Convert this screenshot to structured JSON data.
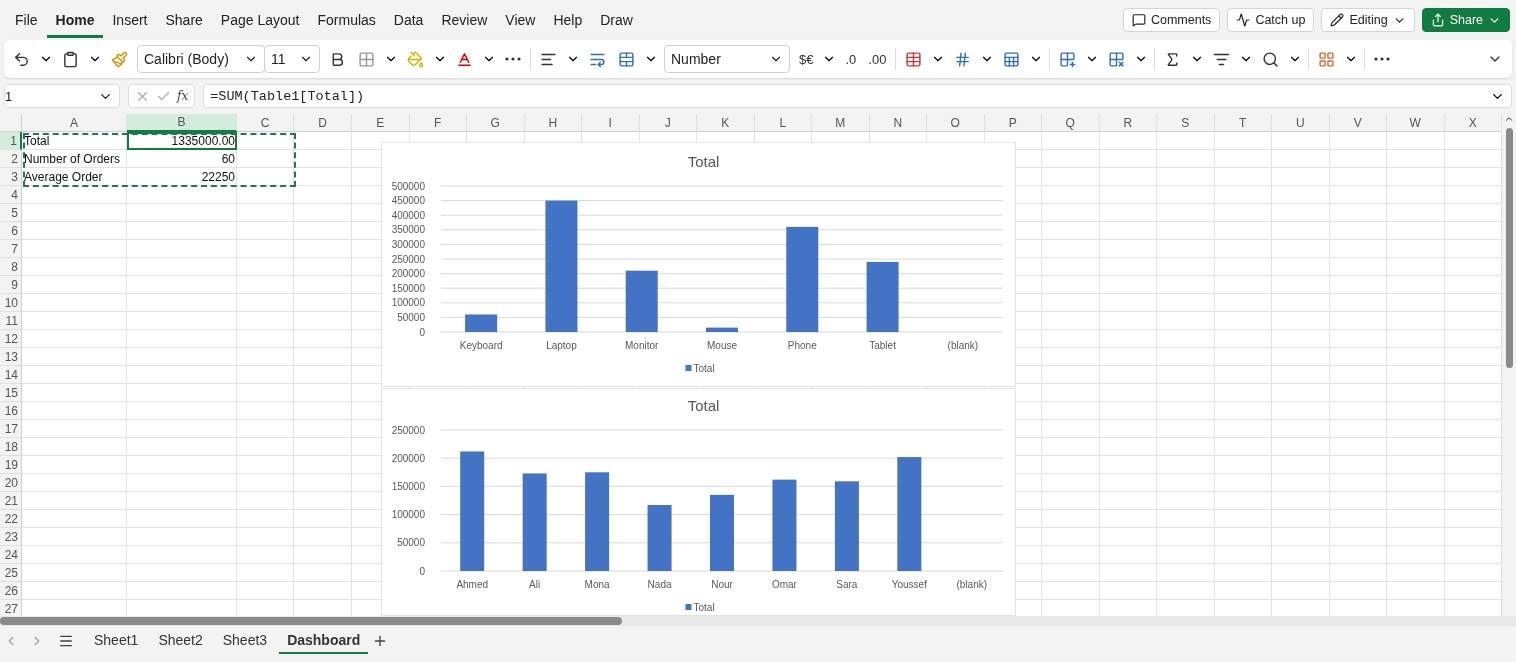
{
  "menu_tabs": [
    {
      "label": "File",
      "selected": false
    },
    {
      "label": "Home",
      "selected": true
    },
    {
      "label": "Insert",
      "selected": false
    },
    {
      "label": "Share",
      "selected": false
    },
    {
      "label": "Page Layout",
      "selected": false
    },
    {
      "label": "Formulas",
      "selected": false
    },
    {
      "label": "Data",
      "selected": false
    },
    {
      "label": "Review",
      "selected": false
    },
    {
      "label": "View",
      "selected": false
    },
    {
      "label": "Help",
      "selected": false
    },
    {
      "label": "Draw",
      "selected": false
    }
  ],
  "top_buttons": [
    {
      "kind": "comments",
      "label": "Comments"
    },
    {
      "kind": "catchup",
      "label": "Catch up"
    },
    {
      "kind": "editing",
      "label": "Editing"
    },
    {
      "kind": "share",
      "label": "Share"
    }
  ],
  "toolbar": {
    "font": "Calibri (Body)",
    "size": "11",
    "number_format": "Number",
    "currency": "$€",
    "decrease_decimal": ".0",
    "increase_decimal": ".00"
  },
  "formula_bar": {
    "name_box": "1",
    "function_label": "fx",
    "formula": "=SUM(Table1[Total])"
  },
  "sheet": {
    "columns": [
      {
        "label": "A",
        "selected": false
      },
      {
        "label": "B",
        "selected": true
      },
      {
        "label": "C",
        "selected": false
      },
      {
        "label": "D",
        "selected": false
      },
      {
        "label": "E",
        "selected": false
      },
      {
        "label": "F",
        "selected": false
      },
      {
        "label": "G",
        "selected": false
      },
      {
        "label": "H",
        "selected": false
      },
      {
        "label": "I",
        "selected": false
      },
      {
        "label": "J",
        "selected": false
      },
      {
        "label": "K",
        "selected": false
      },
      {
        "label": "L",
        "selected": false
      },
      {
        "label": "M",
        "selected": false
      },
      {
        "label": "N",
        "selected": false
      },
      {
        "label": "O",
        "selected": false
      },
      {
        "label": "P",
        "selected": false
      },
      {
        "label": "Q",
        "selected": false
      },
      {
        "label": "R",
        "selected": false
      },
      {
        "label": "S",
        "selected": false
      },
      {
        "label": "T",
        "selected": false
      },
      {
        "label": "U",
        "selected": false
      },
      {
        "label": "V",
        "selected": false
      },
      {
        "label": "W",
        "selected": false
      },
      {
        "label": "X",
        "selected": false
      }
    ],
    "rows": [
      {
        "label": "1",
        "selected": true,
        "cells": [
          "Total",
          "1335000.00"
        ]
      },
      {
        "label": "2",
        "selected": false,
        "cells": [
          "Number of Orders",
          "60"
        ]
      },
      {
        "label": "3",
        "selected": false,
        "cells": [
          "Average Order",
          "22250"
        ]
      },
      {
        "label": "4",
        "selected": false
      },
      {
        "label": "5",
        "selected": false
      },
      {
        "label": "6",
        "selected": false
      },
      {
        "label": "7",
        "selected": false
      },
      {
        "label": "8",
        "selected": false
      },
      {
        "label": "9",
        "selected": false
      },
      {
        "label": "10",
        "selected": false
      },
      {
        "label": "11",
        "selected": false
      },
      {
        "label": "12",
        "selected": false
      },
      {
        "label": "13",
        "selected": false
      },
      {
        "label": "14",
        "selected": false
      },
      {
        "label": "15",
        "selected": false
      },
      {
        "label": "16",
        "selected": false
      },
      {
        "label": "17",
        "selected": false
      },
      {
        "label": "18",
        "selected": false
      },
      {
        "label": "19",
        "selected": false
      },
      {
        "label": "20",
        "selected": false
      },
      {
        "label": "21",
        "selected": false
      },
      {
        "label": "22",
        "selected": false
      },
      {
        "label": "23",
        "selected": false
      },
      {
        "label": "24",
        "selected": false
      },
      {
        "label": "25",
        "selected": false
      },
      {
        "label": "26",
        "selected": false
      },
      {
        "label": "27",
        "selected": false
      }
    ]
  },
  "charts": [
    {
      "chart_data": {
        "type": "bar",
        "title": "Total",
        "categories": [
          "Keyboard",
          "Laptop",
          "Monitor",
          "Mouse",
          "Phone",
          "Tablet",
          "(blank)"
        ],
        "series": [
          {
            "name": "Total",
            "color": "#4472c4",
            "values": [
              60000,
              450000,
              210000,
              15000,
              360000,
              240000,
              null
            ]
          }
        ],
        "grid": true,
        "ylim": [
          0,
          500000
        ],
        "yticks": [
          0,
          50000,
          100000,
          150000,
          200000,
          250000,
          300000,
          350000,
          400000,
          450000,
          500000
        ]
      }
    },
    {
      "chart_data": {
        "type": "bar",
        "title": "Total",
        "categories": [
          "Ahmed",
          "Ali",
          "Mona",
          "Nada",
          "Nour",
          "Omar",
          "Sara",
          "Youssef",
          "(blank)"
        ],
        "series": [
          {
            "name": "Total",
            "color": "#4472c4",
            "values": [
              212000,
              173000,
              175000,
              117000,
              135000,
              162000,
              159000,
              202000,
              null
            ]
          }
        ],
        "grid": true,
        "ylim": [
          0,
          250000
        ],
        "yticks": [
          0,
          50000,
          100000,
          150000,
          200000,
          250000
        ]
      }
    }
  ],
  "sheet_tabs": [
    {
      "label": "Sheet1",
      "selected": false
    },
    {
      "label": "Sheet2",
      "selected": false
    },
    {
      "label": "Sheet3",
      "selected": false
    },
    {
      "label": "Dashboard",
      "selected": true
    }
  ]
}
